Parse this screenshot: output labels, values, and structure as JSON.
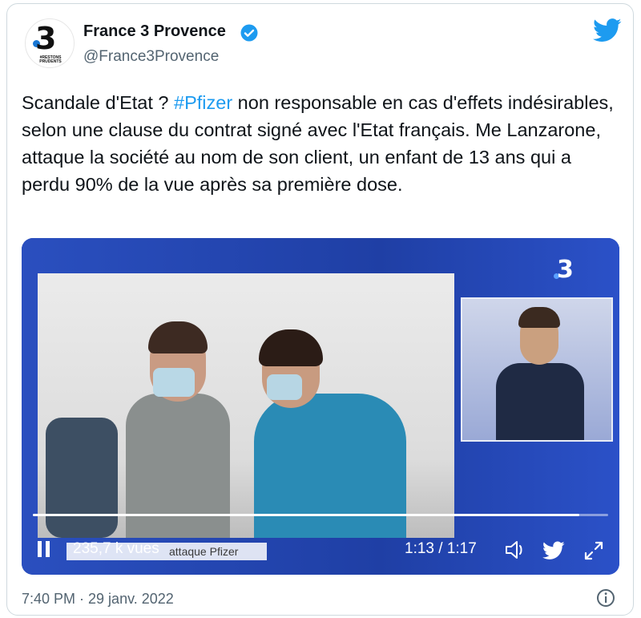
{
  "account": {
    "display_name": "France 3 Provence",
    "handle": "@France3Provence",
    "avatar_mark": "3",
    "avatar_motto": "#RESTONS PRUDENTS"
  },
  "tweet": {
    "text_before": "Scandale d'Etat ? ",
    "hashtag": "#Pfizer",
    "text_after": " non responsable en cas d'effets indésirables, selon une clause du contrat signé avec l'Etat français. Me Lanzarone, attaque la société au nom de son client, un enfant de 13 ans qui a perdu 90% de la vue après sa première dose.",
    "timestamp": "7:40 PM · 29 janv. 2022"
  },
  "video": {
    "channel_logo": "3",
    "views": "235,7 k vues",
    "ticker_text": "attaque Pfizer",
    "time": "1:13 / 1:17",
    "progress": 0.95
  },
  "colors": {
    "accent": "#1d9bf0",
    "text": "#0f1419",
    "muted": "#536471"
  },
  "icons": [
    "verified-badge-icon",
    "twitter-bird-icon",
    "pause-icon",
    "volume-icon",
    "twitter-icon",
    "fullscreen-icon",
    "info-icon"
  ]
}
